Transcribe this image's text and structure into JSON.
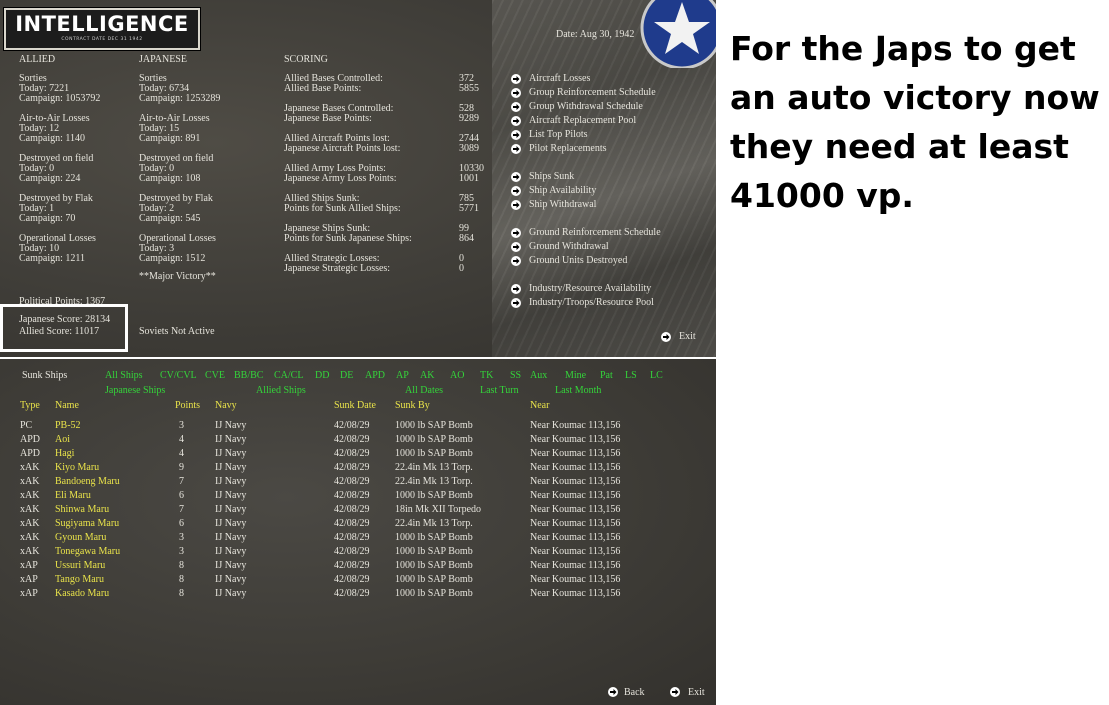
{
  "header": {
    "logo_title": "INTELLIGENCE",
    "logo_subtitle": "CONTRACT DATE DEC 31 1942",
    "date": "Date: Aug 30, 1942"
  },
  "allied": {
    "heading": "ALLIED",
    "lines": [
      "Sorties",
      "Today:     7221",
      "Campaign:  1053792",
      "Air-to-Air Losses",
      "Today:    12",
      "Campaign:  1140",
      "Destroyed on field",
      "Today:    0",
      "Campaign:  224",
      "Destroyed by Flak",
      "Today:    1",
      "Campaign:  70",
      "Operational Losses",
      "Today:    10",
      "Campaign:  1211"
    ]
  },
  "japanese": {
    "heading": "JAPANESE",
    "lines": [
      "Sorties",
      "Today:     6734",
      "Campaign:  1253289",
      "Air-to-Air Losses",
      "Today:    15",
      "Campaign:  891",
      "Destroyed on field",
      "Today:    0",
      "Campaign:  108",
      "Destroyed by Flak",
      "Today:    2",
      "Campaign:  545",
      "Operational Losses",
      "Today:    3",
      "Campaign:  1512"
    ],
    "victory": "**Major Victory**"
  },
  "scoring": {
    "heading": "SCORING",
    "items": [
      {
        "label": "Allied Bases Controlled:",
        "value": "372"
      },
      {
        "label": "Allied Base Points:",
        "value": "5855"
      },
      {
        "label": "Japanese Bases Controlled:",
        "value": "528"
      },
      {
        "label": "Japanese Base Points:",
        "value": "9289"
      },
      {
        "label": "Allied Aircraft Points lost:",
        "value": "2744"
      },
      {
        "label": "Japanese Aircraft Points lost:",
        "value": "3089"
      },
      {
        "label": "Allied Army Loss Points:",
        "value": "10330"
      },
      {
        "label": "Japanese Army Loss Points:",
        "value": "1001"
      },
      {
        "label": "Allied Ships Sunk:",
        "value": "785"
      },
      {
        "label": "Points for Sunk Allied Ships:",
        "value": "5771"
      },
      {
        "label": "Japanese Ships Sunk:",
        "value": "99"
      },
      {
        "label": "Points for Sunk Japanese Ships:",
        "value": "864"
      },
      {
        "label": "Allied Strategic Losses:",
        "value": "0"
      },
      {
        "label": "Japanese Strategic Losses:",
        "value": "0"
      }
    ]
  },
  "political_points": "Political Points: 1367",
  "scores": {
    "japanese": "Japanese Score: 28134",
    "allied": "Allied Score: 11017",
    "soviets": "Soviets Not Active"
  },
  "links": [
    "Aircraft Losses",
    "Group Reinforcement Schedule",
    "Group Withdrawal Schedule",
    "Aircraft Replacement Pool",
    "List Top Pilots",
    "Pilot Replacements",
    "Ships Sunk",
    "Ship Availability",
    "Ship Withdrawal",
    "Ground Reinforcement Schedule",
    "Ground Withdrawal",
    "Ground Units Destroyed",
    "Industry/Resource Availability",
    "Industry/Troops/Resource Pool"
  ],
  "exit_label": "Exit",
  "sunk": {
    "title": "Sunk Ships",
    "filters": [
      "All Ships",
      "CV/CVL",
      "CVE",
      "BB/BC",
      "CA/CL",
      "DD",
      "DE",
      "APD",
      "AP",
      "AK",
      "AO",
      "TK",
      "SS",
      "Aux",
      "Mine",
      "Pat",
      "LS",
      "LC"
    ],
    "side_filters": [
      "Japanese Ships",
      "Allied Ships"
    ],
    "date_filters": [
      "All Dates",
      "Last Turn",
      "Last Month"
    ],
    "columns": [
      "Type",
      "Name",
      "Points",
      "Navy",
      "Sunk Date",
      "Sunk By",
      "Near"
    ],
    "rows": [
      [
        "PC",
        "PB-52",
        "3",
        "IJ Navy",
        "42/08/29",
        "1000 lb SAP Bomb",
        "Near Koumac 113,156"
      ],
      [
        "APD",
        "Aoi",
        "4",
        "IJ Navy",
        "42/08/29",
        "1000 lb SAP Bomb",
        "Near Koumac 113,156"
      ],
      [
        "APD",
        "Hagi",
        "4",
        "IJ Navy",
        "42/08/29",
        "1000 lb SAP Bomb",
        "Near Koumac 113,156"
      ],
      [
        "xAK",
        "Kiyo Maru",
        "9",
        "IJ Navy",
        "42/08/29",
        "22.4in Mk 13 Torp.",
        "Near Koumac 113,156"
      ],
      [
        "xAK",
        "Bandoeng Maru",
        "7",
        "IJ Navy",
        "42/08/29",
        "22.4in Mk 13 Torp.",
        "Near Koumac 113,156"
      ],
      [
        "xAK",
        "Eli Maru",
        "6",
        "IJ Navy",
        "42/08/29",
        "1000 lb SAP Bomb",
        "Near Koumac 113,156"
      ],
      [
        "xAK",
        "Shinwa Maru",
        "7",
        "IJ Navy",
        "42/08/29",
        "18in Mk XII Torpedo",
        "Near Koumac 113,156"
      ],
      [
        "xAK",
        "Sugiyama Maru",
        "6",
        "IJ Navy",
        "42/08/29",
        "22.4in Mk 13 Torp.",
        "Near Koumac 113,156"
      ],
      [
        "xAK",
        "Gyoun Maru",
        "3",
        "IJ Navy",
        "42/08/29",
        "1000 lb SAP Bomb",
        "Near Koumac 113,156"
      ],
      [
        "xAK",
        "Tonegawa Maru",
        "3",
        "IJ Navy",
        "42/08/29",
        "1000 lb SAP Bomb",
        "Near Koumac 113,156"
      ],
      [
        "xAP",
        "Ussuri Maru",
        "8",
        "IJ Navy",
        "42/08/29",
        "1000 lb SAP Bomb",
        "Near Koumac 113,156"
      ],
      [
        "xAP",
        "Tango Maru",
        "8",
        "IJ Navy",
        "42/08/29",
        "1000 lb SAP Bomb",
        "Near Koumac 113,156"
      ],
      [
        "xAP",
        "Kasado Maru",
        "8",
        "IJ Navy",
        "42/08/29",
        "1000 lb SAP Bomb",
        "Near Koumac 113,156"
      ]
    ],
    "back_label": "Back",
    "exit_label": "Exit"
  },
  "annotation": "For the Japs to get an auto victory now they need at least 41000 vp.",
  "colors": {
    "highlight_yellow": "#e9e34a",
    "filter_green": "#34d43a",
    "text_light": "#e6e4dc",
    "panel_bg": "#3f3d38"
  }
}
